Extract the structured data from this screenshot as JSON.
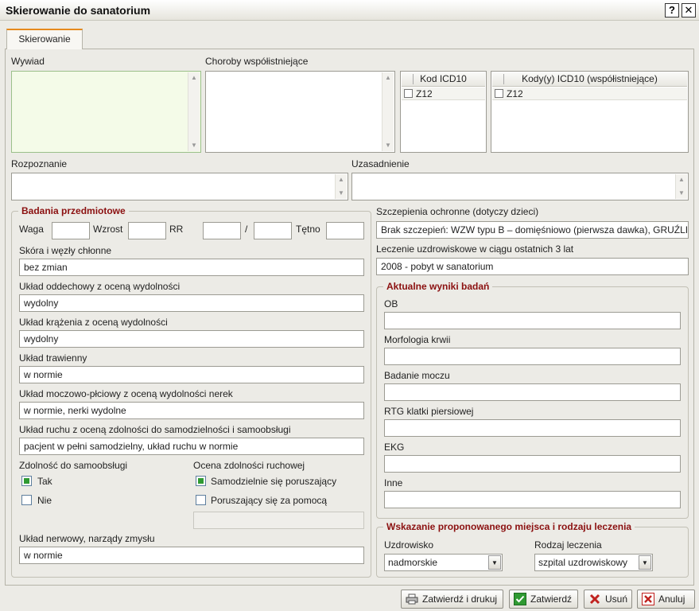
{
  "window": {
    "title": "Skierowanie do sanatorium",
    "help_label": "?",
    "close_label": "✕"
  },
  "tabs": [
    {
      "label": "Skierowanie"
    }
  ],
  "form": {
    "wywiad_label": "Wywiad",
    "choroby_label": "Choroby współistniejące",
    "icd_grid": {
      "header": "Kod ICD10",
      "rows": [
        "Z12"
      ]
    },
    "icd_co_grid": {
      "header": "Kody(y) ICD10 (współistniejące)",
      "rows": [
        "Z12"
      ]
    },
    "rozpoznanie_label": "Rozpoznanie",
    "uzasadnienie_label": "Uzasadnienie"
  },
  "badania": {
    "legend": "Badania przedmiotowe",
    "waga_label": "Waga",
    "wzrost_label": "Wzrost",
    "rr_label": "RR",
    "rr_sep": "/",
    "tetno_label": "Tętno",
    "fields": [
      {
        "label": "Skóra i węzły chłonne",
        "value": "bez zmian"
      },
      {
        "label": "Układ oddechowy z oceną wydolności",
        "value": "wydolny"
      },
      {
        "label": "Układ krążenia z oceną wydolności",
        "value": "wydolny"
      },
      {
        "label": "Układ trawienny",
        "value": "w normie"
      },
      {
        "label": "Układ moczowo-płciowy z oceną wydolności nerek",
        "value": "w normie, nerki wydolne"
      },
      {
        "label": "Układ ruchu z oceną zdolności do samodzielności i samoobsługi",
        "value": "pacjent w pełni samodzielny, układ ruchu w normie"
      }
    ],
    "samoobsluga": {
      "label": "Zdolność do samoobsługi",
      "opt_yes": "Tak",
      "opt_no": "Nie"
    },
    "ruch": {
      "label": "Ocena zdolności ruchowej",
      "opt_a": "Samodzielnie się poruszający",
      "opt_b": "Poruszający się za pomocą"
    },
    "nerwowy": {
      "label": "Układ nerwowy, narządy zmysłu",
      "value": "w normie"
    }
  },
  "szczepienia": {
    "label": "Szczepienia ochronne (dotyczy dzieci)",
    "value": "Brak szczepień: WZW typu B – domięśniowo (pierwsza dawka), GRUŹLICA"
  },
  "leczenie": {
    "label": "Leczenie uzdrowiskowe w ciągu ostatnich 3 lat",
    "value": "2008 - pobyt w sanatorium"
  },
  "wyniki": {
    "legend": "Aktualne wyniki badań",
    "items": [
      {
        "label": "OB"
      },
      {
        "label": "Morfologia krwii"
      },
      {
        "label": "Badanie moczu"
      },
      {
        "label": "RTG klatki piersiowej"
      },
      {
        "label": "EKG"
      },
      {
        "label": "Inne"
      }
    ]
  },
  "wskazanie": {
    "legend": "Wskazanie proponowanego miejsca i rodzaju leczenia",
    "uzdrowisko_label": "Uzdrowisko",
    "uzdrowisko_value": "nadmorskie",
    "rodzaj_label": "Rodzaj leczenia",
    "rodzaj_value": "szpital uzdrowiskowy"
  },
  "buttons": {
    "confirm_print": "Zatwierdź i drukuj",
    "confirm": "Zatwierdź",
    "delete": "Usuń",
    "cancel": "Anuluj"
  },
  "colors": {
    "legend": "#8b1010",
    "check": "#2f9a32",
    "tab_accent": "#e68a1e",
    "delete_x": "#c0221f"
  }
}
